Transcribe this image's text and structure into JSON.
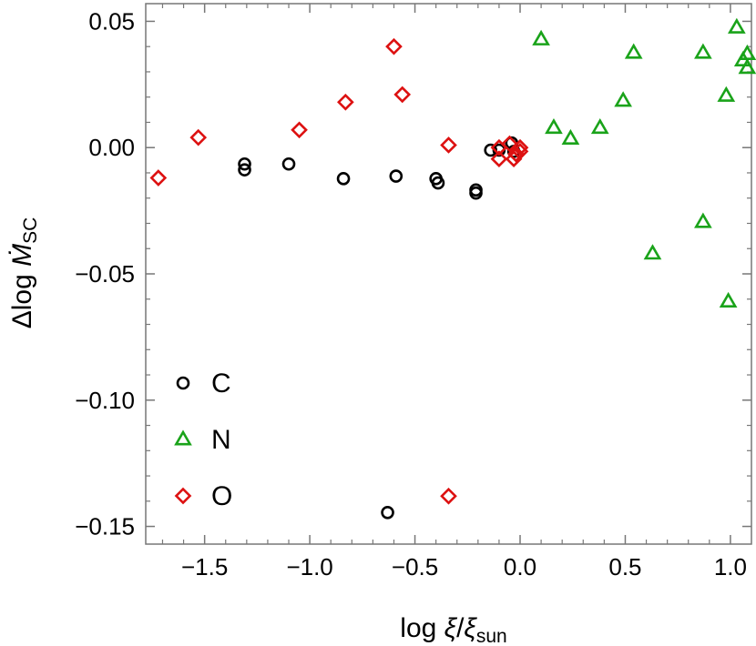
{
  "chart_data": {
    "type": "scatter",
    "xlabel": {
      "main": "log ",
      "var": "ξ",
      "slash": "/",
      "var2": "ξ",
      "sub": "sun"
    },
    "ylabel": {
      "main": "Δlog ",
      "var": "Ṁ",
      "sub": "SC"
    },
    "xlim": [
      -1.78,
      1.1
    ],
    "ylim": [
      -0.157,
      0.057
    ],
    "xticks": [
      {
        "v": -1.5,
        "label": "−1.5"
      },
      {
        "v": -1.0,
        "label": "−1.0"
      },
      {
        "v": -0.5,
        "label": "−0.5"
      },
      {
        "v": 0.0,
        "label": "0.0"
      },
      {
        "v": 0.5,
        "label": "0.5"
      },
      {
        "v": 1.0,
        "label": "1.0"
      }
    ],
    "yticks": [
      {
        "v": 0.05,
        "label": "0.05"
      },
      {
        "v": 0.0,
        "label": "0.00"
      },
      {
        "v": -0.05,
        "label": "−0.05"
      },
      {
        "v": -0.1,
        "label": "−0.10"
      },
      {
        "v": -0.15,
        "label": "−0.15"
      }
    ],
    "grid": false,
    "legend_position": "bottom-left",
    "series": [
      {
        "name": "C",
        "marker": "circle",
        "color": "#000000",
        "points": [
          [
            -1.31,
            -0.0065
          ],
          [
            -1.31,
            -0.0088
          ],
          [
            -1.1,
            -0.0065
          ],
          [
            -0.84,
            -0.0123
          ],
          [
            -0.59,
            -0.0113
          ],
          [
            -0.4,
            -0.0123
          ],
          [
            -0.39,
            -0.014
          ],
          [
            -0.21,
            -0.0168
          ],
          [
            -0.21,
            -0.018
          ],
          [
            -0.63,
            -0.1445
          ],
          [
            -0.14,
            -0.001
          ],
          [
            -0.1,
            -0.001
          ],
          [
            -0.04,
            0.0018
          ],
          [
            -0.03,
            -0.0015
          ]
        ]
      },
      {
        "name": "N",
        "marker": "triangle",
        "color": "#1aa31a",
        "points": [
          [
            0.1,
            0.0428
          ],
          [
            0.16,
            0.0078
          ],
          [
            0.24,
            0.0035
          ],
          [
            0.38,
            0.0078
          ],
          [
            0.49,
            0.0185
          ],
          [
            0.54,
            0.0375
          ],
          [
            0.63,
            -0.042
          ],
          [
            0.87,
            0.0375
          ],
          [
            0.87,
            -0.0295
          ],
          [
            0.98,
            0.0205
          ],
          [
            0.99,
            -0.061
          ],
          [
            1.03,
            0.0475
          ],
          [
            1.06,
            0.0345
          ],
          [
            1.08,
            0.037
          ],
          [
            1.08,
            0.0315
          ]
        ]
      },
      {
        "name": "O",
        "marker": "diamond",
        "color": "#dd1111",
        "points": [
          [
            -1.72,
            -0.012
          ],
          [
            -1.53,
            0.004
          ],
          [
            -1.05,
            0.007
          ],
          [
            -0.83,
            0.018
          ],
          [
            -0.6,
            0.04
          ],
          [
            -0.56,
            0.021
          ],
          [
            -0.34,
            0.001
          ],
          [
            -0.34,
            -0.138
          ],
          [
            -0.1,
            0.0
          ],
          [
            -0.1,
            -0.0045
          ],
          [
            -0.05,
            0.0015
          ],
          [
            -0.03,
            -0.0045
          ],
          [
            -0.02,
            -0.0025
          ],
          [
            0.0,
            -0.0015
          ],
          [
            0.0,
            0.0
          ]
        ]
      }
    ]
  }
}
